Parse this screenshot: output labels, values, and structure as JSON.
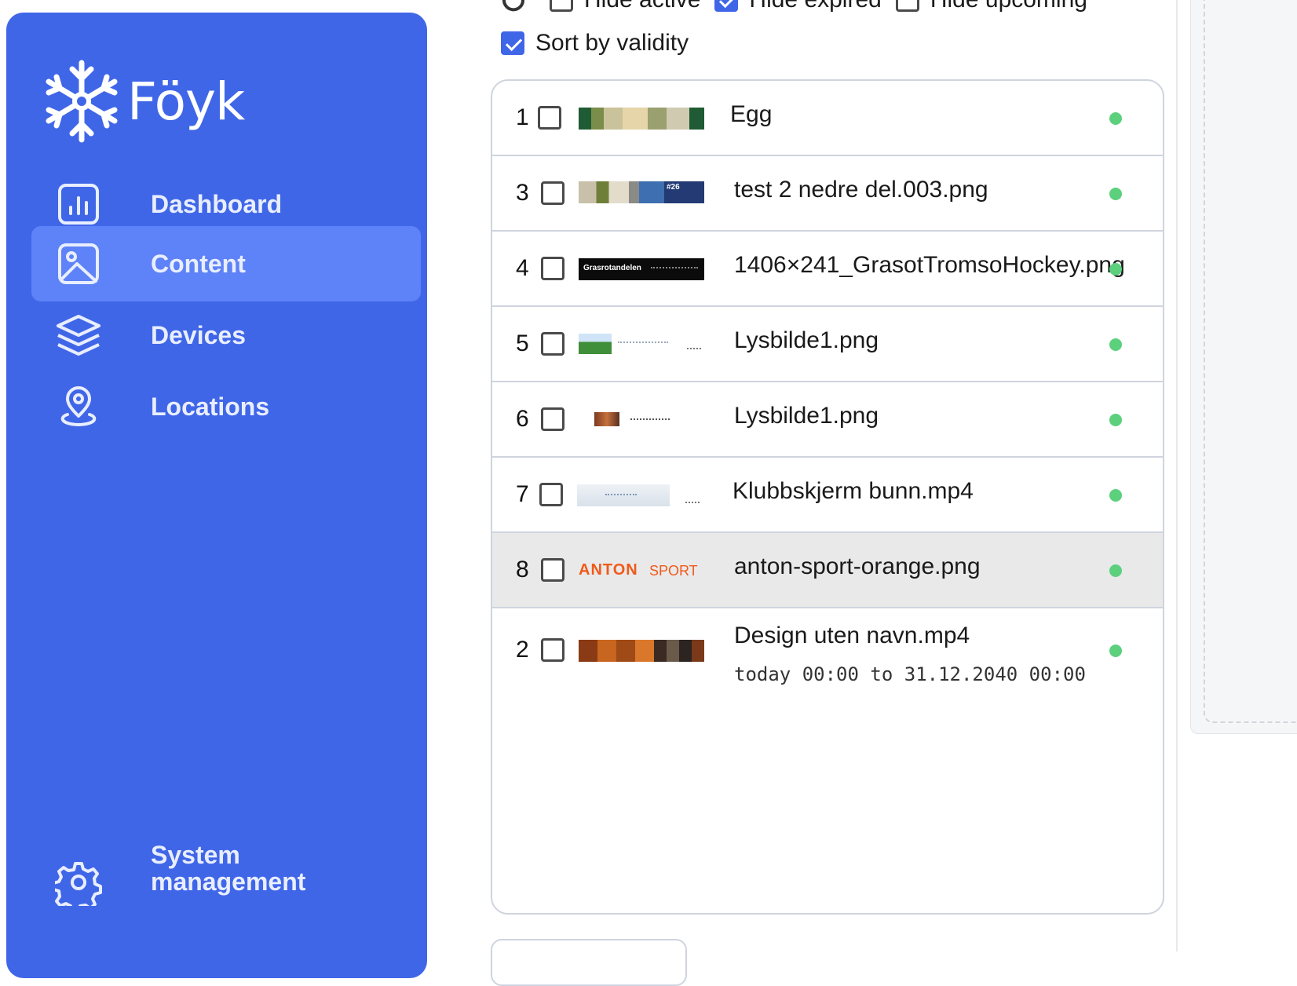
{
  "app": {
    "brand": "Föyk"
  },
  "sidebar": {
    "items": [
      {
        "label": "Dashboard",
        "icon": "bar-chart-icon"
      },
      {
        "label": "Content",
        "icon": "image-icon",
        "active": true
      },
      {
        "label": "Devices",
        "icon": "layers-icon"
      },
      {
        "label": "Locations",
        "icon": "map-pin-icon"
      },
      {
        "label": "System management",
        "icon": "gear-icon"
      }
    ]
  },
  "filters": {
    "hide_active": {
      "label": "Hide active",
      "checked": false
    },
    "hide_expired": {
      "label": "Hide expired",
      "checked": true
    },
    "hide_upcoming": {
      "label": "Hide upcoming",
      "checked": false
    },
    "sort_by_validity": {
      "label": "Sort by validity",
      "checked": true
    }
  },
  "content_list": [
    {
      "num": "1",
      "name": "Egg",
      "sub": "",
      "thumb": "food-photo",
      "status": "active"
    },
    {
      "num": "3",
      "name": "test 2 nedre del.003.png",
      "sub": "",
      "thumb": "collage",
      "status": "active"
    },
    {
      "num": "4",
      "name": "1406×241_GrasotTromsoHockey.png",
      "sub": "",
      "thumb": "grasrotandelen-banner",
      "status": "active"
    },
    {
      "num": "5",
      "name": "Lysbilde1.png",
      "sub": "",
      "thumb": "golf-slide",
      "status": "active"
    },
    {
      "num": "6",
      "name": "Lysbilde1.png",
      "sub": "",
      "thumb": "small-slide",
      "status": "active"
    },
    {
      "num": "7",
      "name": "Klubbskjerm bunn.mp4",
      "sub": "",
      "thumb": "light-banner",
      "status": "active"
    },
    {
      "num": "8",
      "name": "anton-sport-orange.png",
      "sub": "",
      "thumb": "anton-sport-logo",
      "status": "active",
      "highlighted": true
    },
    {
      "num": "2",
      "name": "Design uten navn.mp4",
      "sub": "today 00:00 to 31.12.2040 00:00",
      "thumb": "food-video",
      "status": "active"
    }
  ],
  "thumb_text": {
    "grasrotandelen": "Grasrotandelen",
    "anton": "ANTON",
    "sport": "SPORT",
    "collage_badge": "#26"
  },
  "colors": {
    "accent": "#4066E8",
    "active_nav": "#5E82F7",
    "status_active": "#5cd07d"
  }
}
